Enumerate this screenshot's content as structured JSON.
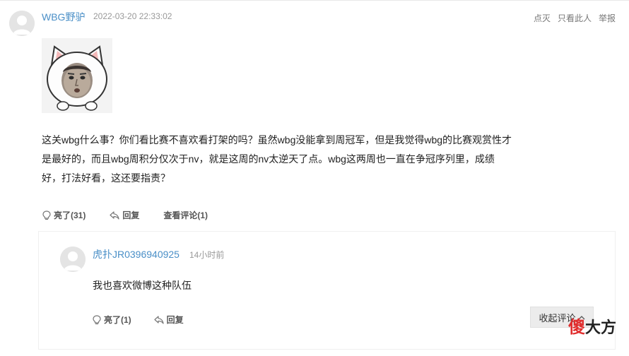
{
  "post": {
    "username": "WBG野驴",
    "time": "2022-03-20 22:33:02",
    "actions": {
      "light_off": "点灭",
      "only_this": "只看此人",
      "report": "举报"
    },
    "emoji_icon": "cat-face-meme",
    "content": "这关wbg什么事？你们看比赛不喜欢看打架的吗？虽然wbg没能拿到周冠军，但是我觉得wbg的比赛观赏性才是最好的，而且wbg周积分仅次于nv，就是这周的nv太逆天了点。wbg这两周也一直在争冠序列里，成绩好，打法好看，这还要指责？",
    "content_lines": [
      "这关wbg什么事？你们看比赛不喜欢看打架的吗？虽然wbg没能拿到周冠军，但是我觉得wbg的比赛观赏性才",
      "是最好的，而且wbg周积分仅次于nv，就是这周的nv太逆天了点。wbg这两周也一直在争冠序列里，成绩",
      "好，打法好看，这还要指责？"
    ],
    "buttons": {
      "like": "亮了(31)",
      "reply": "回复",
      "view_comments": "查看评论(1)"
    }
  },
  "reply": {
    "username": "虎扑JR0396940925",
    "time": "14小时前",
    "content": "我也喜欢微博这种队伍",
    "buttons": {
      "like": "亮了(1)",
      "reply": "回复",
      "collapse": "收起评论"
    }
  },
  "watermark": {
    "red": "傻",
    "black": "大方"
  }
}
